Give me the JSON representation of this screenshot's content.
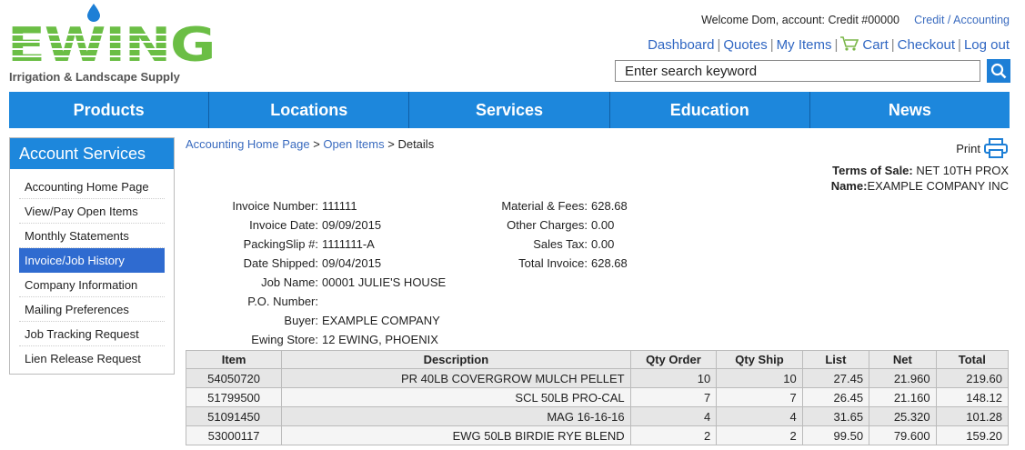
{
  "brand": {
    "logo_text": "EWING",
    "tagline": "Irrigation & Landscape Supply",
    "green": "#6bbe45",
    "accent_blue": "#1d87dc"
  },
  "header": {
    "welcome": "Welcome Dom, account: Credit #00000",
    "account_link": "Credit / Accounting",
    "links": {
      "dashboard": "Dashboard",
      "quotes": "Quotes",
      "my_items": "My Items",
      "cart": "Cart",
      "checkout": "Checkout",
      "logout": "Log out"
    },
    "search_value": "Enter search keyword"
  },
  "nav": [
    "Products",
    "Locations",
    "Services",
    "Education",
    "News"
  ],
  "sidebar": {
    "title": "Account Services",
    "items": [
      "Accounting Home Page",
      "View/Pay Open Items",
      "Monthly Statements",
      "Invoice/Job History",
      "Company Information",
      "Mailing Preferences",
      "Job Tracking Request",
      "Lien Release Request"
    ],
    "active_item": "Invoice/Job History"
  },
  "breadcrumb": {
    "home": "Accounting Home Page",
    "sep1": " > ",
    "open_items": "Open Items",
    "sep2": " > ",
    "current": "Details"
  },
  "print_label": "Print",
  "terms": {
    "terms_label": "Terms of Sale:",
    "terms_value": "NET 10TH PROX",
    "name_label": "Name:",
    "name_value": "EXAMPLE COMPANY INC"
  },
  "invoice": {
    "invoice_number_label": "Invoice Number:",
    "invoice_number": "111111",
    "invoice_date_label": "Invoice Date:",
    "invoice_date": "09/09/2015",
    "packing_slip_label": "PackingSlip #:",
    "packing_slip": "1111111-A",
    "date_shipped_label": "Date Shipped:",
    "date_shipped": "09/04/2015",
    "job_name_label": "Job Name:",
    "job_name": "00001 JULIE'S HOUSE",
    "po_number_label": "P.O. Number:",
    "po_number": "",
    "buyer_label": "Buyer:",
    "buyer": "EXAMPLE COMPANY",
    "store_label": "Ewing Store:",
    "store": "12 EWING, PHOENIX"
  },
  "totals": {
    "material_label": "Material & Fees:",
    "material": "628.68",
    "other_label": "Other Charges:",
    "other": "0.00",
    "tax_label": "Sales Tax:",
    "tax": "0.00",
    "total_label": "Total Invoice:",
    "total": "628.68"
  },
  "table": {
    "headers": [
      "Item",
      "Description",
      "Qty Order",
      "Qty Ship",
      "List",
      "Net",
      "Total"
    ],
    "rows": [
      [
        "54050720",
        "PR 40LB COVERGROW MULCH PELLET",
        "10",
        "10",
        "27.45",
        "21.960",
        "219.60"
      ],
      [
        "51799500",
        "SCL 50LB PRO-CAL",
        "7",
        "7",
        "26.45",
        "21.160",
        "148.12"
      ],
      [
        "51091450",
        "MAG 16-16-16",
        "4",
        "4",
        "31.65",
        "25.320",
        "101.28"
      ],
      [
        "53000117",
        "EWG 50LB BIRDIE RYE BLEND",
        "2",
        "2",
        "99.50",
        "79.600",
        "159.20"
      ]
    ]
  }
}
